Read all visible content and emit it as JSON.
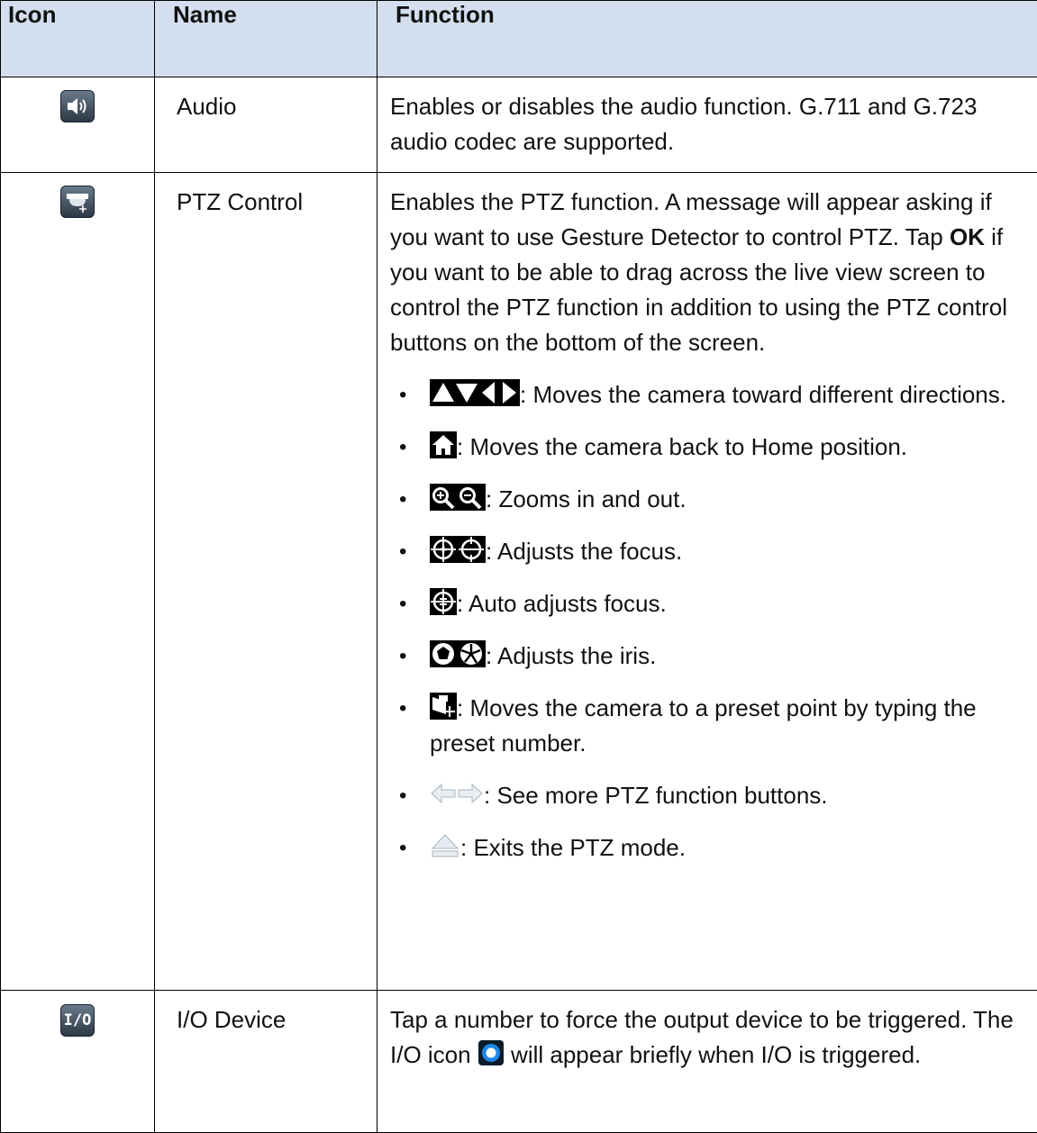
{
  "table": {
    "headers": {
      "icon": "Icon",
      "name": "Name",
      "function": "Function"
    },
    "rows": {
      "audio": {
        "icon": "speaker-icon",
        "name": "Audio",
        "function": "Enables or disables the audio function. G.711 and G.723 audio codec are supported."
      },
      "ptz": {
        "icon": "ptz-camera-icon",
        "name": "PTZ Control",
        "function": {
          "part1": "Enables the PTZ function. A message will appear asking if you want to use Gesture Detector to control PTZ. Tap ",
          "bold": "OK",
          "part2": " if you want to be able to drag across the live view screen to control the PTZ function in addition to using the PTZ control buttons on the bottom of the screen."
        },
        "bullets": [
          {
            "icons": [
              "arrow-up-icon",
              "arrow-down-icon",
              "arrow-left-icon",
              "arrow-right-icon"
            ],
            "text": ": Moves the camera toward different directions."
          },
          {
            "icons": [
              "home-icon"
            ],
            "text": ": Moves the camera back to Home position."
          },
          {
            "icons": [
              "zoom-in-icon",
              "zoom-out-icon"
            ],
            "text": ": Zooms in and out."
          },
          {
            "icons": [
              "focus-near-icon",
              "focus-far-icon"
            ],
            "text": ": Adjusts the focus."
          },
          {
            "icons": [
              "auto-focus-icon"
            ],
            "text": ": Auto adjusts focus."
          },
          {
            "icons": [
              "iris-close-icon",
              "iris-open-icon"
            ],
            "text": ": Adjusts the iris."
          },
          {
            "icons": [
              "preset-icon"
            ],
            "text": ": Moves the camera to a preset point by typing the preset number."
          },
          {
            "icons": [
              "prev-arrow-icon",
              "next-arrow-icon"
            ],
            "text": ": See more PTZ function buttons."
          },
          {
            "icons": [
              "eject-icon"
            ],
            "text": ": Exits the PTZ mode."
          }
        ]
      },
      "io": {
        "icon": "io-icon",
        "icon_label": "I/O",
        "name": "I/O Device",
        "function_before": "Tap a number to force the output device to be triggered. The I/O icon ",
        "inline_icon": "io-status-ring-icon",
        "function_after": " will appear briefly when I/O is triggered."
      }
    }
  },
  "colors": {
    "header_bg": "#d3dfee",
    "io_ring": "#1e88e5"
  }
}
